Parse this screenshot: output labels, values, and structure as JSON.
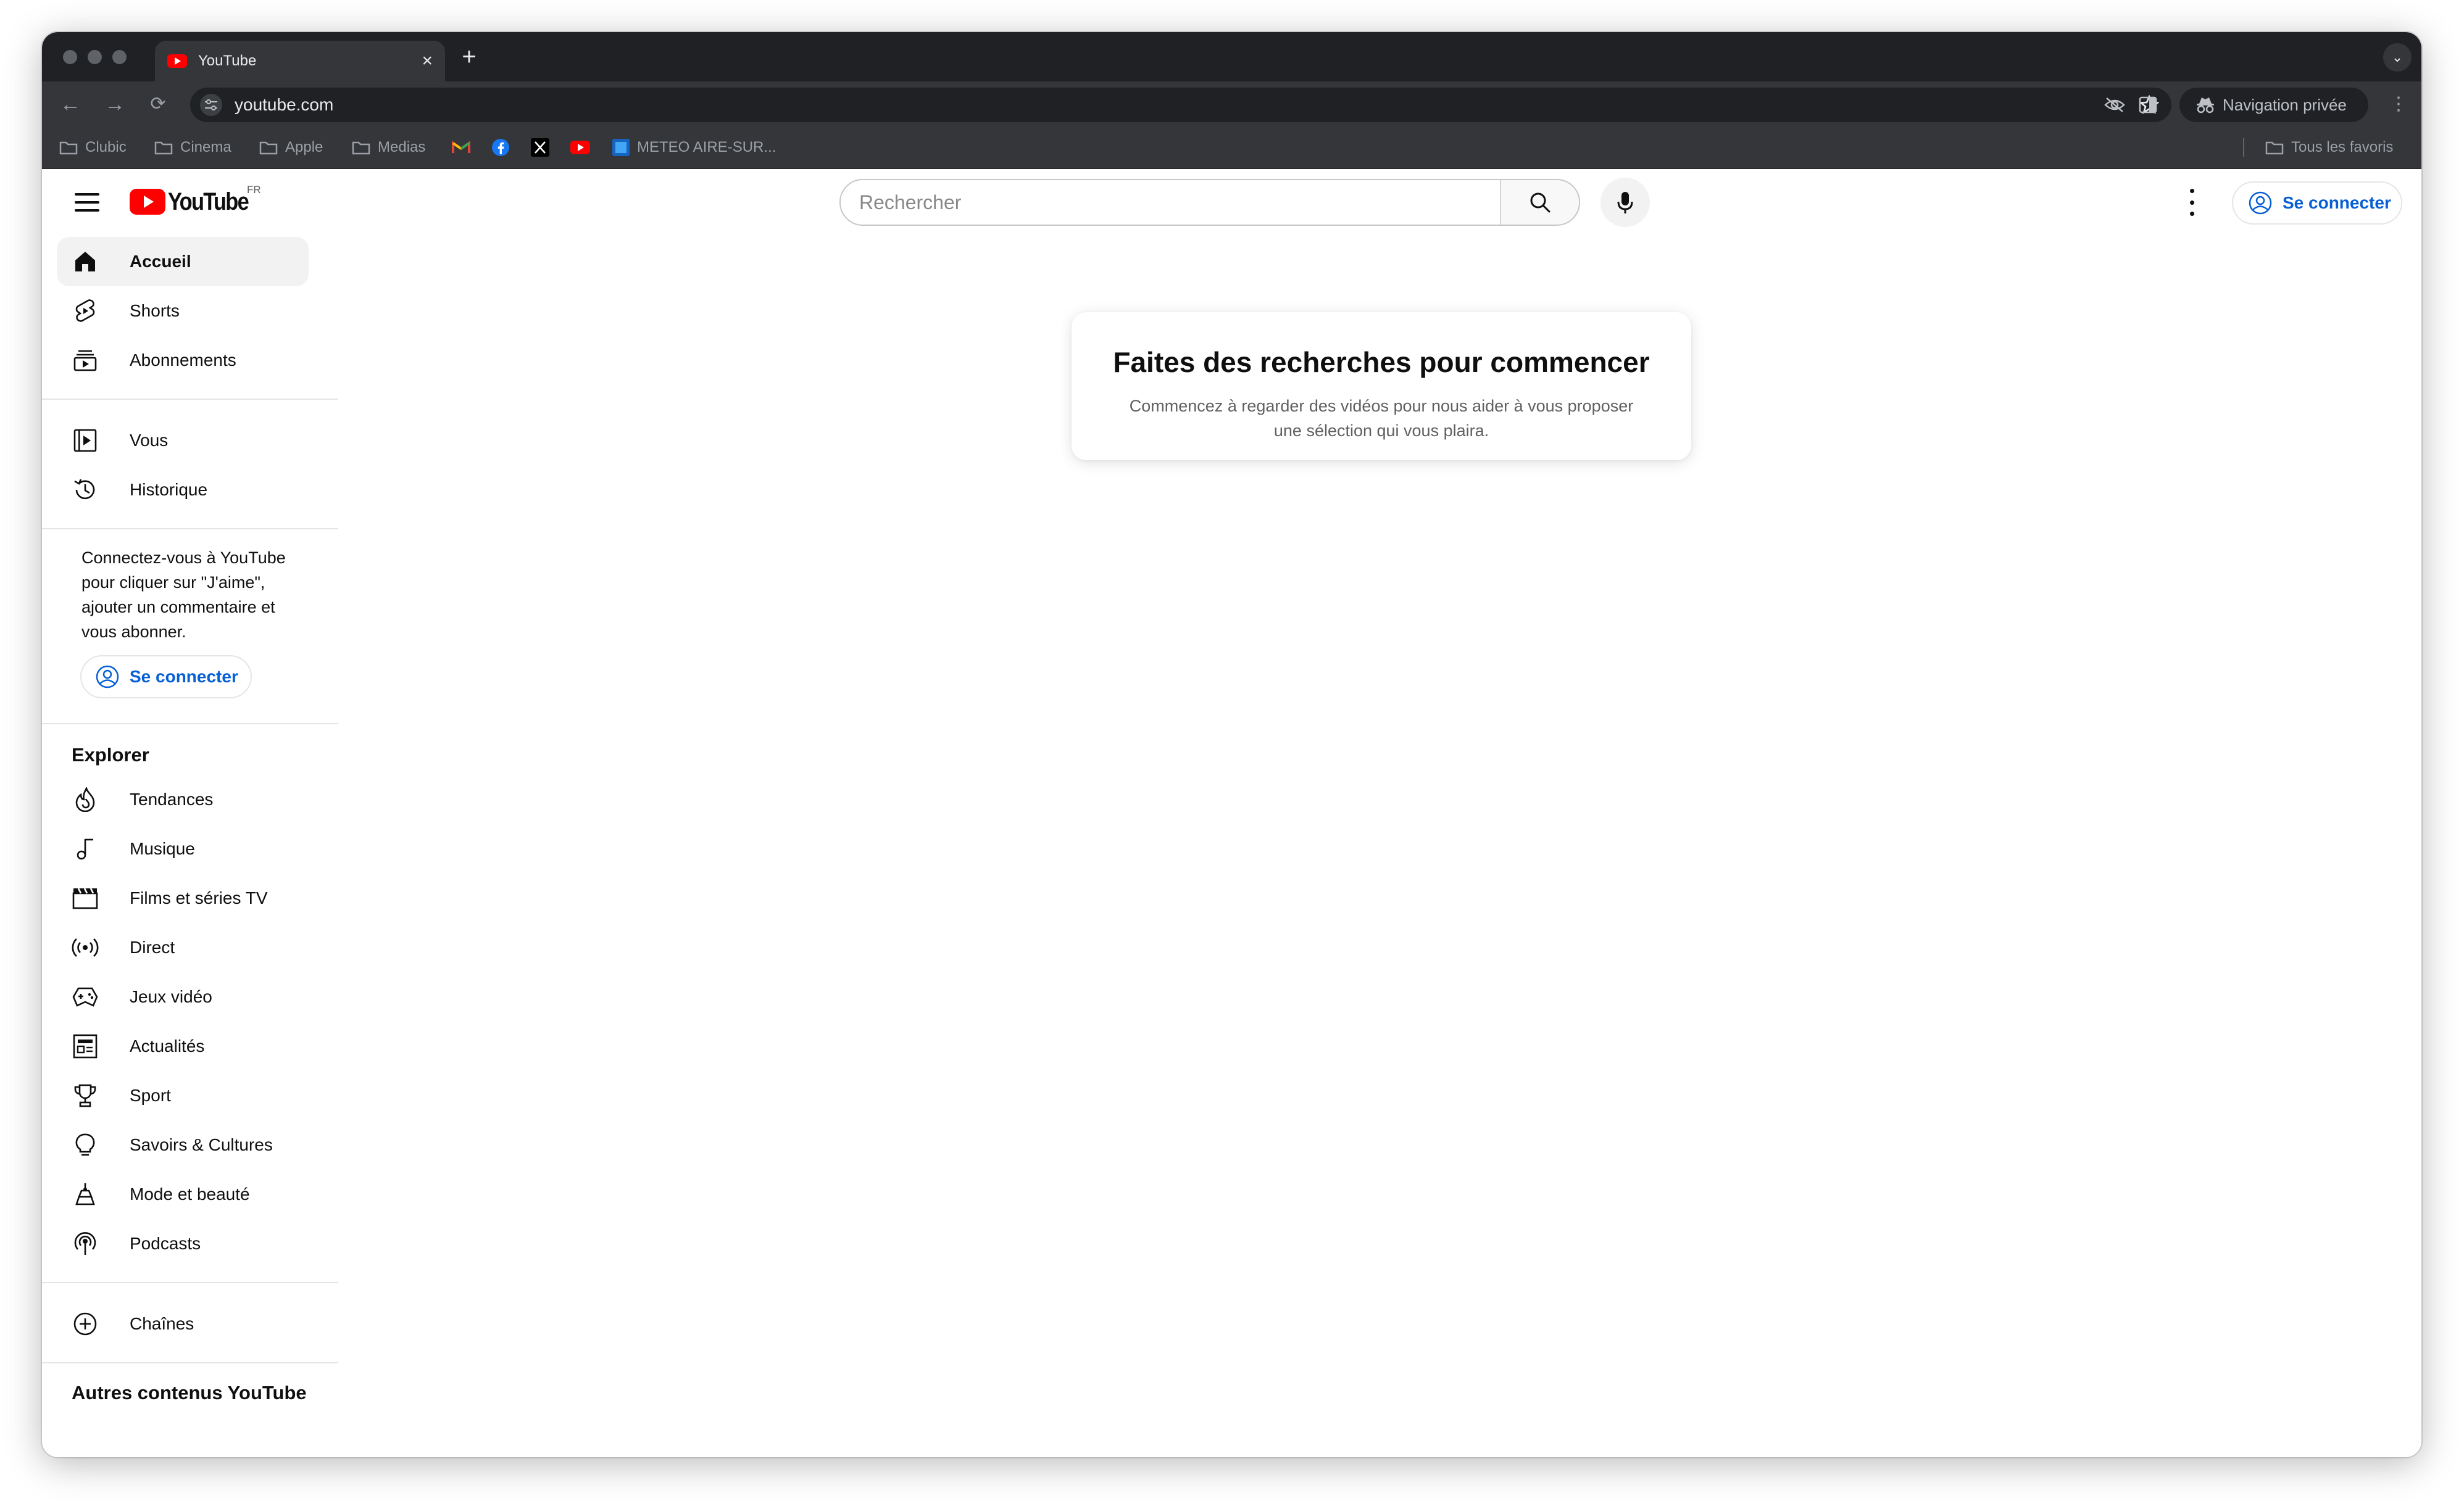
{
  "browser": {
    "tab_title": "YouTube",
    "url": "youtube.com",
    "private_label": "Navigation privée",
    "bookmarks": [
      {
        "label": "Clubic"
      },
      {
        "label": "Cinema"
      },
      {
        "label": "Apple"
      },
      {
        "label": "Medias"
      },
      {
        "label": "METEO AIRE-SUR..."
      }
    ],
    "all_bookmarks": "Tous les favoris"
  },
  "header": {
    "logo_text": "YouTube",
    "country_code": "FR",
    "search_placeholder": "Rechercher",
    "signin_label": "Se connecter"
  },
  "sidebar": {
    "main": [
      {
        "label": "Accueil",
        "icon": "home-icon",
        "active": true
      },
      {
        "label": "Shorts",
        "icon": "shorts-icon"
      },
      {
        "label": "Abonnements",
        "icon": "subscriptions-icon"
      }
    ],
    "you": [
      {
        "label": "Vous",
        "icon": "library-icon"
      },
      {
        "label": "Historique",
        "icon": "history-icon"
      }
    ],
    "signin_prompt": "Connectez-vous à YouTube pour cliquer sur \"J'aime\", ajouter un commentaire et vous abonner.",
    "signin_label": "Se connecter",
    "explore_title": "Explorer",
    "explore": [
      {
        "label": "Tendances",
        "icon": "trending-icon"
      },
      {
        "label": "Musique",
        "icon": "music-icon"
      },
      {
        "label": "Films et séries TV",
        "icon": "movies-icon"
      },
      {
        "label": "Direct",
        "icon": "live-icon"
      },
      {
        "label": "Jeux vidéo",
        "icon": "gaming-icon"
      },
      {
        "label": "Actualités",
        "icon": "news-icon"
      },
      {
        "label": "Sport",
        "icon": "trophy-icon"
      },
      {
        "label": "Savoirs & Cultures",
        "icon": "lightbulb-icon"
      },
      {
        "label": "Mode et beauté",
        "icon": "fashion-icon"
      },
      {
        "label": "Podcasts",
        "icon": "podcast-icon"
      }
    ],
    "channels": {
      "label": "Chaînes",
      "icon": "add-circle-icon"
    },
    "more_title": "Autres contenus YouTube"
  },
  "main": {
    "card_title": "Faites des recherches pour commencer",
    "card_body": "Commencez à regarder des vidéos pour nous aider à vous proposer une sélection qui vous plaira."
  },
  "colors": {
    "brand_red": "#ff0000",
    "link_blue": "#065fd4",
    "chrome_dark": "#35363a"
  }
}
